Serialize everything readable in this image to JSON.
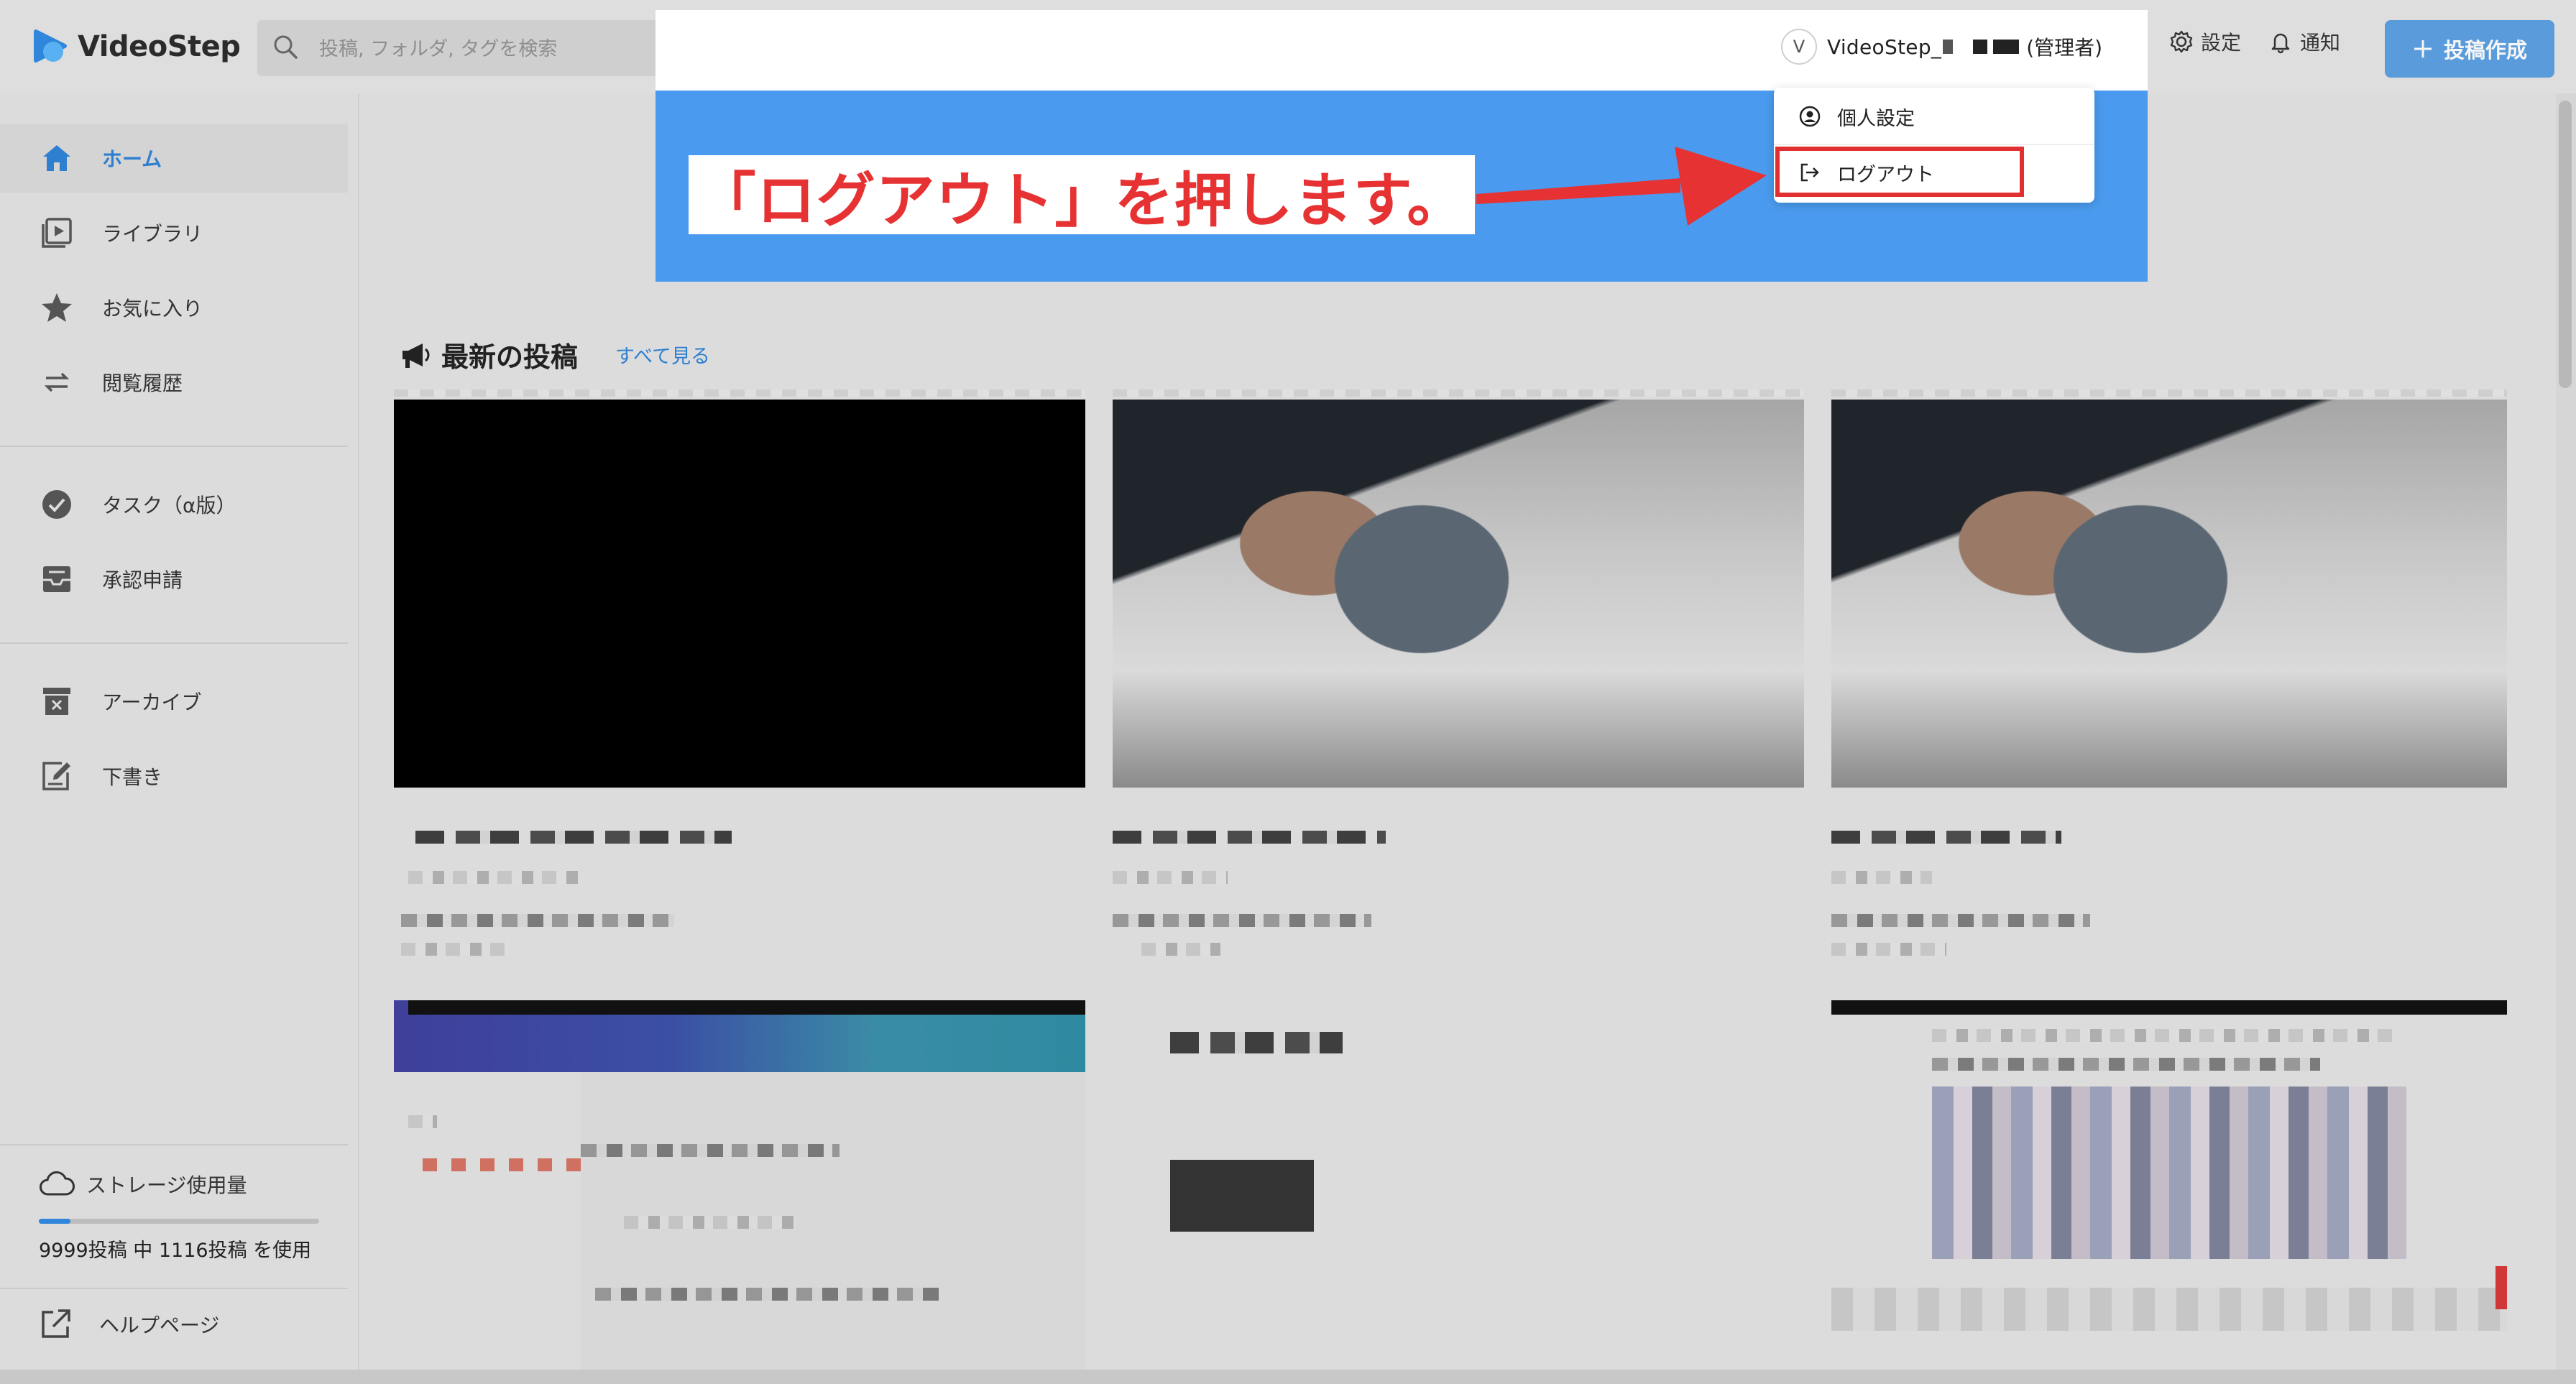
{
  "app": {
    "name": "VideoStep",
    "brand_color": "#2f86da"
  },
  "search": {
    "placeholder": "投稿, フォルダ, タグを検索"
  },
  "user": {
    "avatar_initial": "V",
    "name": "VideoStep_",
    "role": "(管理者)"
  },
  "header": {
    "settings_label": "設定",
    "notifications_label": "通知",
    "create_label": "投稿作成"
  },
  "dropdown": {
    "items": [
      {
        "label": "個人設定",
        "icon": "user-circle-icon"
      },
      {
        "label": "ログアウト",
        "icon": "logout-icon"
      }
    ]
  },
  "callout": {
    "text": "「ログアウト」を押します。",
    "color": "#e63232"
  },
  "sidebar": {
    "items": [
      {
        "label": "ホーム",
        "icon": "home-icon",
        "active": true
      },
      {
        "label": "ライブラリ",
        "icon": "library-icon"
      },
      {
        "label": "お気に入り",
        "icon": "star-icon"
      },
      {
        "label": "閲覧履歴",
        "icon": "history-icon"
      },
      {
        "label": "タスク（α版）",
        "icon": "task-check-icon"
      },
      {
        "label": "承認申請",
        "icon": "inbox-icon"
      },
      {
        "label": "アーカイブ",
        "icon": "archive-icon"
      },
      {
        "label": "下書き",
        "icon": "draft-edit-icon"
      }
    ],
    "storage": {
      "title": "ストレージ使用量",
      "usage_text": "9999投稿 中 1116投稿 を使用",
      "used": 1116,
      "total": 9999
    },
    "help_label": "ヘルプページ"
  },
  "main": {
    "section_title": "最新の投稿",
    "see_all": "すべて見る"
  }
}
